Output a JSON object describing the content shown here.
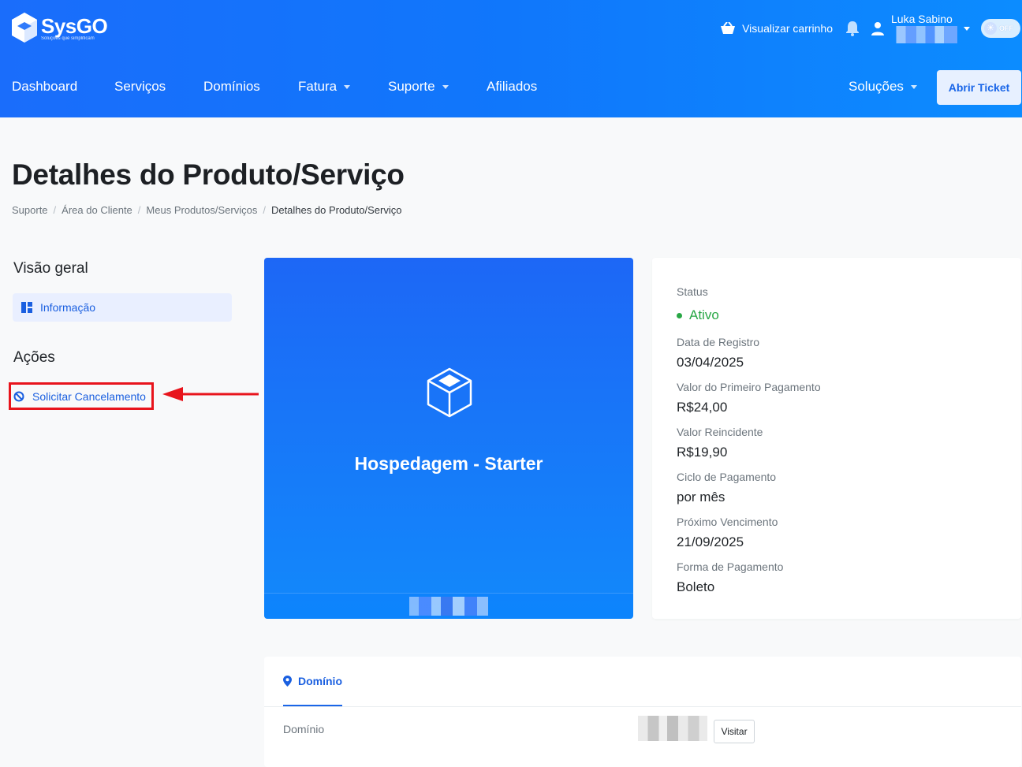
{
  "brand": {
    "name": "SysGO",
    "tagline": "Soluções que simplificam"
  },
  "topbar": {
    "cart_label": "Visualizar carrinho",
    "user_name": "Luka Sabino",
    "theme_toggle_label": "OFF"
  },
  "nav": {
    "items": [
      {
        "label": "Dashboard",
        "dropdown": false
      },
      {
        "label": "Serviços",
        "dropdown": false
      },
      {
        "label": "Domínios",
        "dropdown": false
      },
      {
        "label": "Fatura",
        "dropdown": true
      },
      {
        "label": "Suporte",
        "dropdown": true
      },
      {
        "label": "Afiliados",
        "dropdown": false
      }
    ],
    "right_item": {
      "label": "Soluções",
      "dropdown": true
    },
    "ticket_button": "Abrir Ticket"
  },
  "page": {
    "title": "Detalhes do Produto/Serviço",
    "breadcrumb": [
      "Suporte",
      "Área do Cliente",
      "Meus Produtos/Serviços",
      "Detalhes do Produto/Serviço"
    ]
  },
  "sidebar": {
    "overview_heading": "Visão geral",
    "overview_item": "Informação",
    "actions_heading": "Ações",
    "actions_item": "Solicitar Cancelamento"
  },
  "product": {
    "name": "Hospedagem - Starter"
  },
  "details": {
    "status_label": "Status",
    "status_value": "Ativo",
    "fields": [
      {
        "label": "Data de Registro",
        "value": "03/04/2025"
      },
      {
        "label": "Valor do Primeiro Pagamento",
        "value": "R$24,00"
      },
      {
        "label": "Valor Reincidente",
        "value": "R$19,90"
      },
      {
        "label": "Ciclo de Pagamento",
        "value": "por mês"
      },
      {
        "label": "Próximo Vencimento",
        "value": "21/09/2025"
      },
      {
        "label": "Forma de Pagamento",
        "value": "Boleto"
      }
    ]
  },
  "domain_section": {
    "tab_label": "Domínio",
    "row_label": "Domínio",
    "visit_button": "Visitar"
  },
  "colors": {
    "header_blue": "#1077fb",
    "accent_blue": "#1a5fe0",
    "status_green": "#28a745",
    "highlight_red": "#e8141c"
  }
}
